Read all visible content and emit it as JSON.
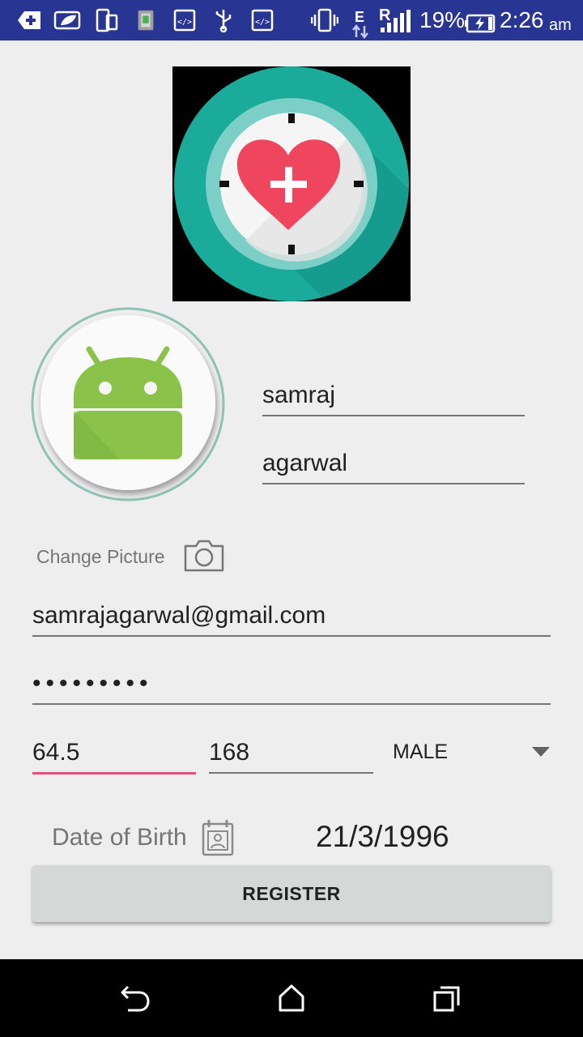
{
  "status_bar": {
    "battery": "19%",
    "time": "2:26",
    "ampm": "am",
    "network_e": "E",
    "network_r": "R",
    "bg_color": "#283593",
    "left_icons": [
      "add-box-icon",
      "leaf-icon",
      "tablet-icon",
      "archive-icon",
      "code-icon",
      "usb-icon",
      "code-icon"
    ],
    "right_icons": [
      "vibrate-icon",
      "data-arrows-icon",
      "signal-icon",
      "battery-charging-icon"
    ]
  },
  "logo": {
    "icon": "heart-clock-logo",
    "accent": "#1aab9b",
    "heart_color": "#f0455f"
  },
  "profile": {
    "avatar_icon": "android-avatar-icon"
  },
  "form": {
    "first_name": "samraj",
    "last_name": "agarwal",
    "change_picture_label": "Change Picture",
    "camera_icon": "camera-icon",
    "email": "samrajagarwal@gmail.com",
    "password_mask": "•••••••••",
    "weight": "64.5",
    "height": "168",
    "gender": "MALE",
    "dob_label": "Date of Birth",
    "dob_icon": "calendar-contact-icon",
    "dob_value": "21/3/1996",
    "register_label": "REGISTER"
  },
  "nav_bar": {
    "icons": [
      "back-icon",
      "home-icon",
      "recents-icon"
    ]
  }
}
